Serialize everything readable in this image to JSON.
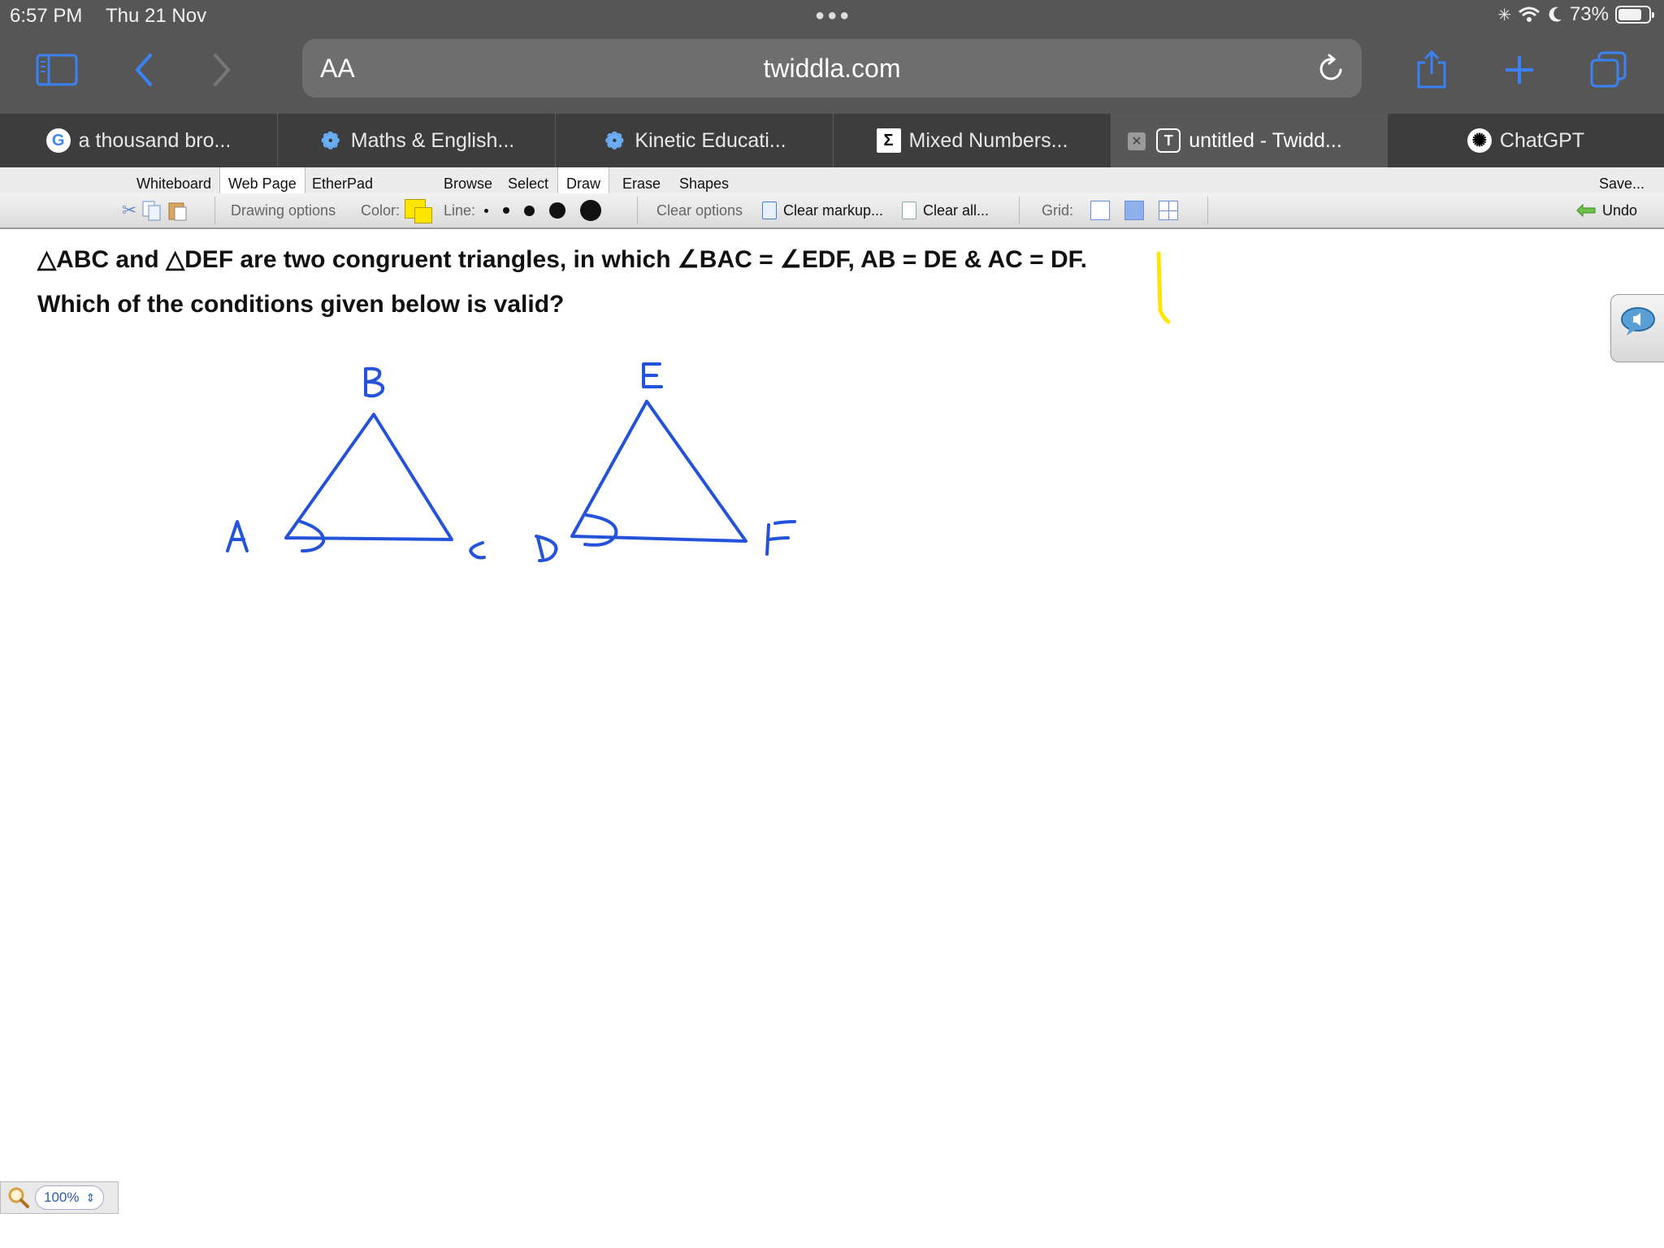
{
  "status_bar": {
    "time": "6:57 PM",
    "date": "Thu 21 Nov",
    "battery": "73%",
    "battery_level": 0.73
  },
  "browser": {
    "aa_label": "AA",
    "url": "twiddla.com",
    "tabs": [
      {
        "title": "a thousand bro...",
        "icon": "google-icon"
      },
      {
        "title": "Maths & English...",
        "icon": "flower-icon"
      },
      {
        "title": "Kinetic Educati...",
        "icon": "flower-icon"
      },
      {
        "title": "Mixed Numbers...",
        "icon": "sigma-icon"
      },
      {
        "title": "untitled - Twidd...",
        "icon": "t-icon",
        "active": true
      },
      {
        "title": "ChatGPT",
        "icon": "chatgpt-icon"
      }
    ]
  },
  "app": {
    "tabs": [
      "Whiteboard",
      "Web Page",
      "EtherPad"
    ],
    "active_tab": "Web Page",
    "tools": [
      "Browse",
      "Select",
      "Draw",
      "Erase",
      "Shapes"
    ],
    "active_tool": "Draw",
    "save_label": "Save...",
    "options": {
      "drawing_options": "Drawing options",
      "color_label": "Color:",
      "color_value": "#ffe600",
      "line_label": "Line:",
      "clear_options": "Clear options",
      "clear_markup": "Clear markup...",
      "clear_all": "Clear all...",
      "grid_label": "Grid:",
      "undo": "Undo"
    }
  },
  "question": {
    "line1": "△ABC and △DEF are two congruent triangles, in which ∠BAC = ∠EDF, AB = DE & AC = DF.",
    "line2": "Which of the conditions given below is valid?"
  },
  "drawing": {
    "labels": {
      "a": "A",
      "b": "B",
      "c": "C",
      "d": "D",
      "e": "E",
      "f": "F"
    },
    "ink_color": "#2453d9",
    "highlight_color": "#ffe600"
  },
  "zoom": {
    "value": "100%"
  }
}
